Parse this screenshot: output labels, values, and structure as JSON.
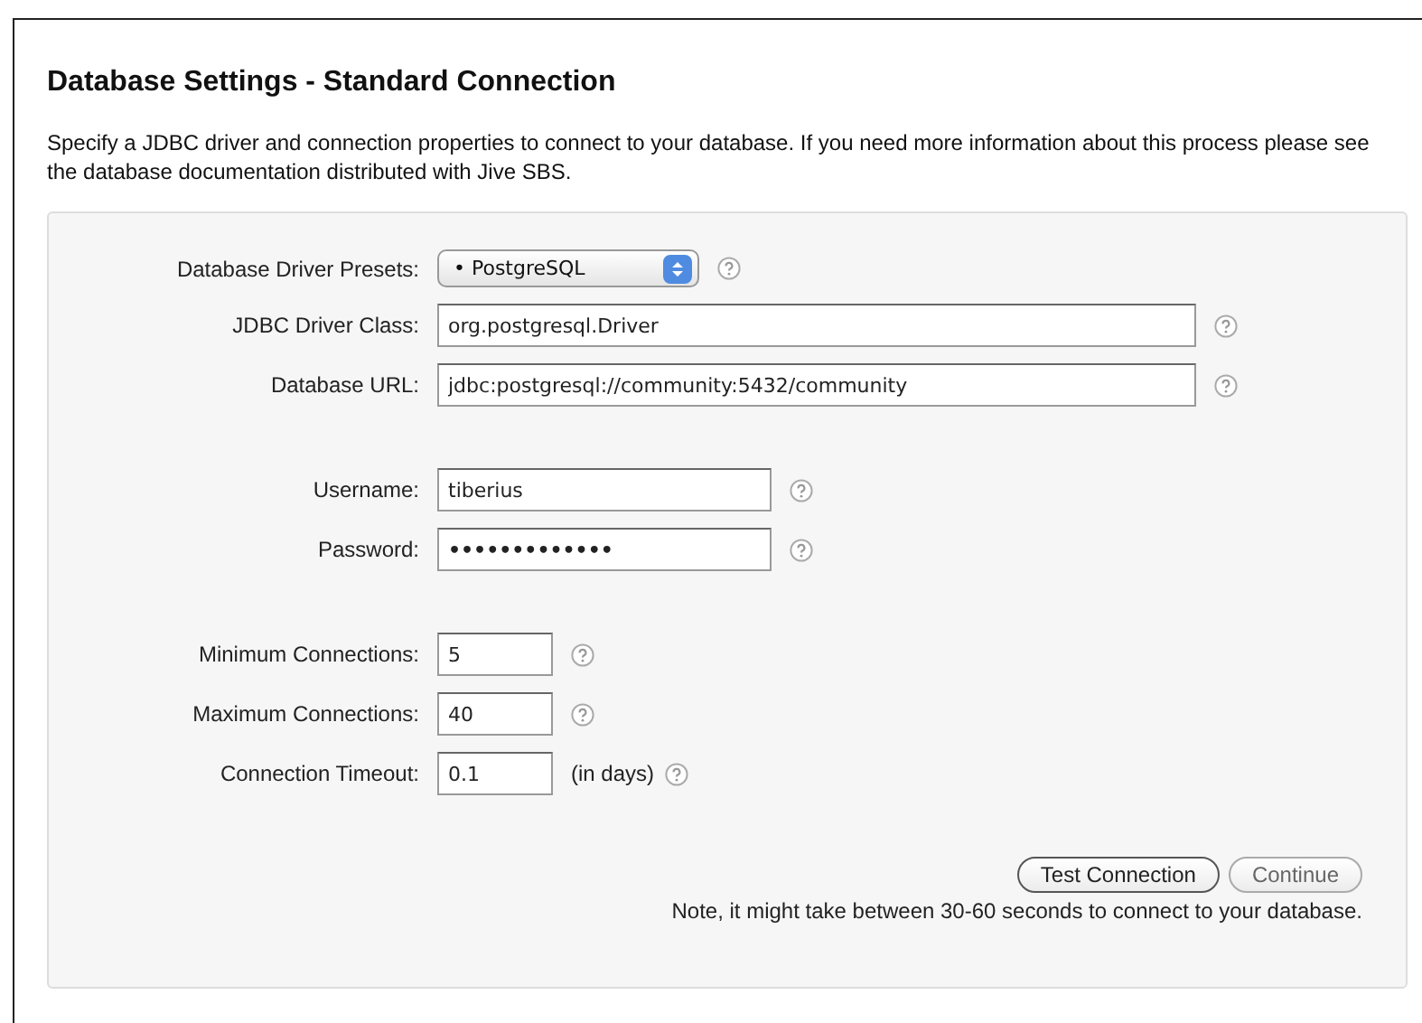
{
  "title": "Database Settings - Standard Connection",
  "description": "Specify a JDBC driver and connection properties to connect to your database. If you need more information about this process please see the database documentation distributed with Jive SBS.",
  "groups": [
    {
      "fields": [
        {
          "label": "Database Driver Presets:",
          "kind": "select",
          "value": "• PostgreSQL"
        },
        {
          "label": "JDBC Driver Class:",
          "kind": "text",
          "value": "org.postgresql.Driver"
        },
        {
          "label": "Database URL:",
          "kind": "text",
          "value": "jdbc:postgresql://community:5432/community"
        }
      ]
    },
    {
      "fields": [
        {
          "label": "Username:",
          "kind": "text",
          "value": "tiberius"
        },
        {
          "label": "Password:",
          "kind": "password",
          "value": "•••••••••••••"
        }
      ]
    },
    {
      "fields": [
        {
          "label": "Minimum Connections:",
          "kind": "text",
          "value": "5"
        },
        {
          "label": "Maximum Connections:",
          "kind": "text",
          "value": "40"
        },
        {
          "label": "Connection Timeout:",
          "kind": "text",
          "value": "0.1",
          "suffix": "(in days)"
        }
      ]
    }
  ],
  "buttons": [
    {
      "label": "Test Connection",
      "hovered": true
    },
    {
      "label": "Continue",
      "hovered": false
    }
  ],
  "note": "Note, it might take between 30-60 seconds to connect to your database."
}
